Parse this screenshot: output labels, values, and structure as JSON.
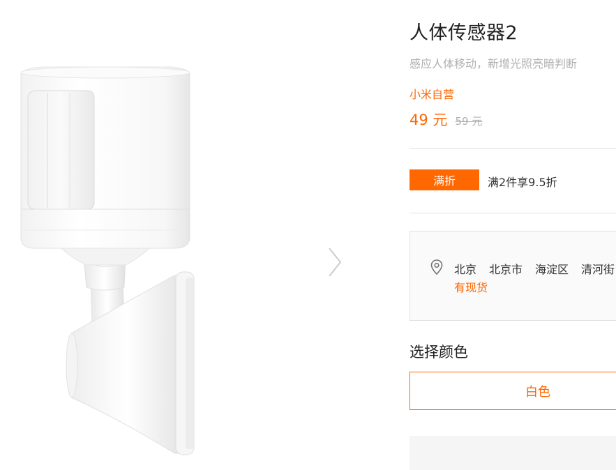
{
  "product": {
    "title": "人体传感器2",
    "subtitle": "感应人体移动，新增光照亮暗判断",
    "seller": "小米自营",
    "price": "49 元",
    "original_price": "59 元",
    "image_icon": "motion-sensor-product-image",
    "next_icon": "chevron-right-icon"
  },
  "promotion": {
    "badge": "满折",
    "text": "满2件享9.5折"
  },
  "delivery": {
    "location_icon": "map-pin-icon",
    "address": [
      "北京",
      "北京市",
      "海淀区",
      "清河街"
    ],
    "stock_status": "有现货"
  },
  "options": {
    "color_title": "选择颜色",
    "selected_color": "白色"
  },
  "colors": {
    "accent": "#ff6700",
    "muted": "#b0b0b0",
    "divider": "#e0e0e0",
    "title": "#212121"
  }
}
